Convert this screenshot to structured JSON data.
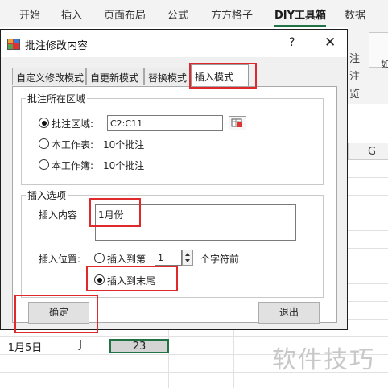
{
  "ribbon": {
    "tabs": [
      "开始",
      "插入",
      "页面布局",
      "公式",
      "方方格子",
      "DIY工具箱",
      "数据"
    ],
    "right_fragments": [
      "注",
      "注",
      "览",
      "如"
    ]
  },
  "sheet": {
    "column_header": "G",
    "row_cells": [
      "1月5日",
      "J",
      "23"
    ]
  },
  "dialog": {
    "title": "批注修改内容",
    "help": "?",
    "close": "✕",
    "tabs": [
      "自定义修改模式",
      "自更新模式",
      "替换模式",
      "插入模式"
    ],
    "area_group": {
      "label": "批注所在区域",
      "options": [
        {
          "label": "批注区域:",
          "value": "C2:C11",
          "selected": true
        },
        {
          "label": "本工作表:",
          "value": "10个批注",
          "selected": false
        },
        {
          "label": "本工作簿:",
          "value": "10个批注",
          "selected": false
        }
      ]
    },
    "insert_group": {
      "label": "插入选项",
      "content_label": "插入内容",
      "content_value": "1月份",
      "position_label": "插入位置:",
      "opt_first_label": "插入到第",
      "spin_value": "1",
      "chars_before": "个字符前",
      "opt_end_label": "插入到末尾"
    },
    "ok_label": "确定",
    "exit_label": "退出"
  },
  "watermark": "软件技巧"
}
